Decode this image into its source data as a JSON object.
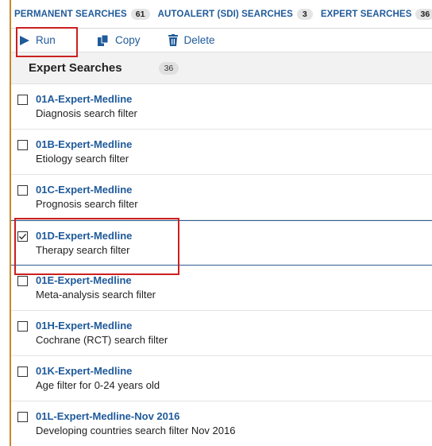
{
  "tabs": [
    {
      "label": "PERMANENT SEARCHES",
      "count": "61"
    },
    {
      "label": "AUTOALERT (SDI) SEARCHES",
      "count": "3"
    },
    {
      "label": "EXPERT SEARCHES",
      "count": "36"
    }
  ],
  "toolbar": {
    "run_label": "Run",
    "copy_label": "Copy",
    "delete_label": "Delete"
  },
  "section": {
    "title": "Expert Searches",
    "count": "36"
  },
  "items": [
    {
      "title": "01A-Expert-Medline",
      "desc": "Diagnosis search filter",
      "checked": false
    },
    {
      "title": "01B-Expert-Medline",
      "desc": "Etiology search filter",
      "checked": false
    },
    {
      "title": "01C-Expert-Medline",
      "desc": "Prognosis search filter",
      "checked": false
    },
    {
      "title": "01D-Expert-Medline",
      "desc": "Therapy search filter",
      "checked": true
    },
    {
      "title": "01E-Expert-Medline",
      "desc": "Meta-analysis search filter",
      "checked": false
    },
    {
      "title": "01H-Expert-Medline",
      "desc": "Cochrane (RCT) search filter",
      "checked": false
    },
    {
      "title": "01K-Expert-Medline",
      "desc": "Age filter for 0-24 years old",
      "checked": false
    },
    {
      "title": "01L-Expert-Medline-Nov 2016",
      "desc": "Developing countries search filter Nov 2016",
      "checked": false
    }
  ],
  "icons": {
    "run": "play-icon",
    "copy": "copy-icon",
    "delete": "trash-icon",
    "check": "checkmark-icon"
  },
  "colors": {
    "link": "#1f5a9a",
    "highlight": "#cc2020",
    "panel_border": "#c8862b"
  }
}
